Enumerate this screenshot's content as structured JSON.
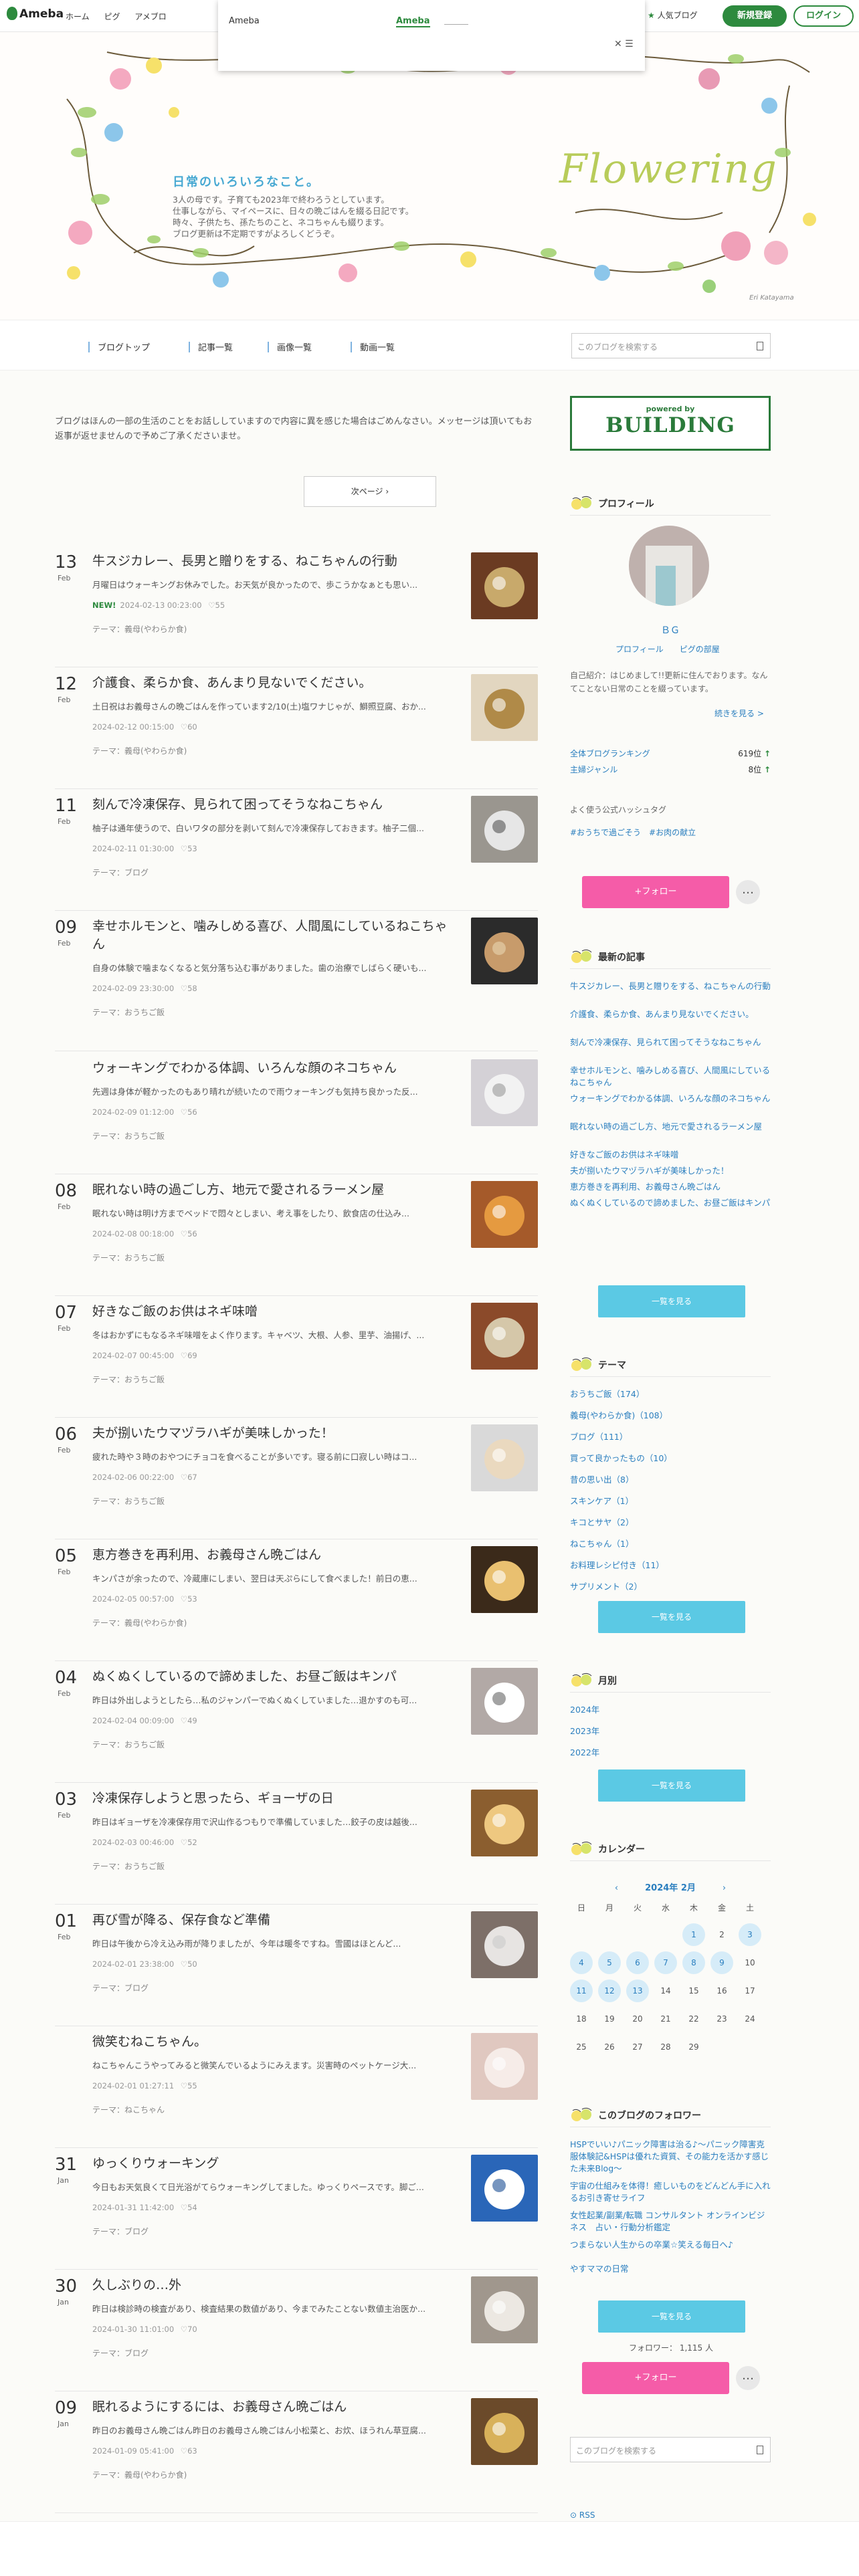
{
  "topbar": {
    "logo": "Ameba",
    "nav": [
      "ホーム",
      "ピグ",
      "アメブロ"
    ],
    "popup_tab1": "Ameba",
    "popup_tab2": "Ameba",
    "popular": "人気ブログ",
    "register": "新規登録",
    "login": "ログイン"
  },
  "header": {
    "title": "日常のいろいろなこと。",
    "desc": [
      "3人の母です。子育ても2023年で終わろうとしています。",
      "仕事しながら、マイペースに、日々の晩ごはんを綴る日記です。",
      "時々、子供たち、孫たちのこと、ネコちゃんも綴ります。",
      "ブログ更新は不定期ですがよろしくどうぞ。"
    ],
    "art_title": "Flowering",
    "signature": "Eri Katayama"
  },
  "blognav": {
    "items": [
      "ブログトップ",
      "記事一覧",
      "画像一覧",
      "動画一覧"
    ],
    "search_placeholder": "このブログを検索する"
  },
  "notice": "ブログはほんの一部の生活のことをお話ししていますので内容に異を感じた場合はごめんなさい。メッセージは頂いてもお返事が返せませんので予めご了承くださいませ。",
  "next_page": "次ページ",
  "articles": [
    {
      "day": "13",
      "mon": "Feb",
      "title": "牛スジカレー、長男と贈りをする、ねこちゃんの行動",
      "excerpt": "月曜日はウォーキングお休みでした。お天気が良かったので、歩こうかなぁとも思い...",
      "new": "NEW!",
      "date": "2024-02-13 00:23:00",
      "likes": "55",
      "theme": "テーマ：義母(やわらか食)"
    },
    {
      "day": "12",
      "mon": "Feb",
      "title": "介護食、柔らか食、あんまり見ないでください。",
      "excerpt": "土日祝はお義母さんの晩ごはんを作っています2/10(土)塩ワナじゃが、鰤照豆腐、おか...",
      "new": "",
      "date": "2024-02-12 00:15:00",
      "likes": "60",
      "theme": "テーマ：義母(やわらか食)"
    },
    {
      "day": "11",
      "mon": "Feb",
      "title": "刻んで冷凍保存、見られて困ってそうなねこちゃん",
      "excerpt": "柚子は通年使うので、白いワタの部分を剥いて刻んで冷凍保存しておきます。柚子二個...",
      "new": "",
      "date": "2024-02-11 01:30:00",
      "likes": "53",
      "theme": "テーマ：ブログ"
    },
    {
      "day": "09",
      "mon": "Feb",
      "title": "幸せホルモンと、噛みしめる喜び、人間風にしているねこちゃん",
      "excerpt": "自身の体験で噛まなくなると気分落ち込む事がありました。歯の治療でしばらく硬いも...",
      "new": "",
      "date": "2024-02-09 23:30:00",
      "likes": "58",
      "theme": "テーマ：おうちご飯"
    },
    {
      "day": "",
      "mon": "",
      "title": "ウォーキングでわかる体調、いろんな顔のネコちゃん",
      "excerpt": "先週は身体が軽かったのもあり晴れが続いたので雨ウォーキングも気持ち良かった反...",
      "new": "",
      "date": "2024-02-09 01:12:00",
      "likes": "56",
      "theme": "テーマ：おうちご飯"
    },
    {
      "day": "08",
      "mon": "Feb",
      "title": "眠れない時の過ごし方、地元で愛されるラーメン屋",
      "excerpt": "眠れない時は明け方までベッドで悶々としまい、考え事をしたり、飲食店の仕込み...",
      "new": "",
      "date": "2024-02-08 00:18:00",
      "likes": "56",
      "theme": "テーマ：おうちご飯"
    },
    {
      "day": "07",
      "mon": "Feb",
      "title": "好きなご飯のお供はネギ味噌",
      "excerpt": "冬はおかずにもなるネギ味噌をよく作ります。キャベツ、大根、人参、里芋、油揚げ、...",
      "new": "",
      "date": "2024-02-07 00:45:00",
      "likes": "69",
      "theme": "テーマ：おうちご飯"
    },
    {
      "day": "06",
      "mon": "Feb",
      "title": "夫が捌いたウマヅラハギが美味しかった！",
      "excerpt": "疲れた時や３時のおやつにチョコを食べることが多いです。寝る前に口寂しい時はコ...",
      "new": "",
      "date": "2024-02-06 00:22:00",
      "likes": "67",
      "theme": "テーマ：おうちご飯"
    },
    {
      "day": "05",
      "mon": "Feb",
      "title": "恵方巻きを再利用、お義母さん晩ごはん",
      "excerpt": "キンパさが余ったので、冷蔵庫にしまい、翌日は天ぷらにして食べました！前日の恵...",
      "new": "",
      "date": "2024-02-05 00:57:00",
      "likes": "53",
      "theme": "テーマ：義母(やわらか食)"
    },
    {
      "day": "04",
      "mon": "Feb",
      "title": "ぬくぬくしているので諦めました、お昼ご飯はキンパ",
      "excerpt": "昨日は外出しようとしたら…私のジャンパーでぬくぬくしていました…退かすのも可...",
      "new": "",
      "date": "2024-02-04 00:09:00",
      "likes": "49",
      "theme": "テーマ：おうちご飯"
    },
    {
      "day": "03",
      "mon": "Feb",
      "title": "冷凍保存しようと思ったら、ギョーザの日",
      "excerpt": "昨日はギョーザを冷凍保存用で沢山作るつもりで準備していました…餃子の皮は越後...",
      "new": "",
      "date": "2024-02-03 00:46:00",
      "likes": "52",
      "theme": "テーマ：おうちご飯"
    },
    {
      "day": "01",
      "mon": "Feb",
      "title": "再び雪が降る、保存食など準備",
      "excerpt": "昨日は午後から冷え込み雨が降りましたが、今年は暖冬ですね。雪國はほとんど...",
      "new": "",
      "date": "2024-02-01 23:38:00",
      "likes": "50",
      "theme": "テーマ：ブログ"
    },
    {
      "day": "",
      "mon": "",
      "title": "微笑むねこちゃん。",
      "excerpt": "ねこちゃんこうやってみると微笑んでいるようにみえます。災害時のペットケージ大...",
      "new": "",
      "date": "2024-02-01 01:27:11",
      "likes": "55",
      "theme": "テーマ：ねこちゃん"
    },
    {
      "day": "31",
      "mon": "Jan",
      "title": "ゆっくりウォーキング",
      "excerpt": "今日もお天気良くて日光浴がてらウォーキングしてました。ゆっくりペースです。脚ご...",
      "new": "",
      "date": "2024-01-31 11:42:00",
      "likes": "54",
      "theme": "テーマ：ブログ"
    },
    {
      "day": "30",
      "mon": "Jan",
      "title": "久しぶりの…外",
      "excerpt": "昨日は検診時の検査があり、検査結果の数値があり、今までみたことない数値主治医か...",
      "new": "",
      "date": "2024-01-30 11:01:00",
      "likes": "70",
      "theme": "テーマ：ブログ"
    },
    {
      "day": "09",
      "mon": "Jan",
      "title": "眠れるようにするには、お義母さん晩ごはん",
      "excerpt": "昨日のお義母さん晩ごはん昨日のお義母さん晩ごはん小松菜と、お炊、ほうれん草豆腐...",
      "new": "",
      "date": "2024-01-09 05:41:00",
      "likes": "63",
      "theme": "テーマ：義母(やわらか食)"
    }
  ],
  "sidebar": {
    "banner_top": "powered by",
    "banner_main": "BUILDING",
    "profile": {
      "heading": "プロフィール",
      "name": "ＢＧ",
      "link1": "プロフィール",
      "link2": "ピグの部屋",
      "bio": "自己紹介：はじめまして!!更新に住んでおります。なんてことない日常のことを綴っています。",
      "more": "続きを見る >",
      "rank1_label": "全体ブログランキング",
      "rank1_value": "619位",
      "rank2_label": "主婦ジャンル",
      "rank2_value": "8位",
      "hashtag_heading": "よく使う公式ハッシュタグ",
      "hashtags": "#おうちで過ごそう　#お肉の献立",
      "follow": "+フォロー",
      "more_icon": "…"
    },
    "latest": {
      "heading": "最新の記事",
      "items": [
        "牛スジカレー、長男と贈りをする、ねこちゃんの行動",
        "介護食、柔らか食、あんまり見ないでください。",
        "刻んで冷凍保存、見られて困ってそうなねこちゃん",
        "幸せホルモンと、噛みしめる喜び、人間風にしているねこちゃん",
        "ウォーキングでわかる体調、いろんな顔のネコちゃん",
        "眠れない時の過ごし方、地元で愛されるラーメン屋",
        "好きなご飯のお供はネギ味噌",
        "夫が捌いたウマヅラハギが美味しかった！",
        "恵方巻きを再利用、お義母さん晩ごはん",
        "ぬくぬくしているので諦めました、お昼ご飯はキンパ"
      ],
      "button": "一覧を見る"
    },
    "themes": {
      "heading": "テーマ",
      "items": [
        "おうちご飯（174）",
        "義母(やわらか食)（108）",
        "ブログ（111）",
        "買って良かったもの（10）",
        "昔の思い出（8）",
        "スキンケア（1）",
        "キコとサヤ（2）",
        "ねこちゃん（1）",
        "お料理レシピ付き（11）",
        "サプリメント（2）"
      ],
      "button": "一覧を見る"
    },
    "monthly": {
      "heading": "月別",
      "items": [
        "2024年",
        "2023年",
        "2022年"
      ],
      "button": "一覧を見る"
    },
    "calendar": {
      "heading": "カレンダー",
      "title": "2024年 2月",
      "prev": "‹",
      "next": "›",
      "weekdays": [
        "日",
        "月",
        "火",
        "水",
        "木",
        "金",
        "土"
      ],
      "rows": [
        [
          "",
          "",
          "",
          "",
          "1",
          "2",
          "3"
        ],
        [
          "4",
          "5",
          "6",
          "7",
          "8",
          "9",
          "10"
        ],
        [
          "11",
          "12",
          "13",
          "14",
          "15",
          "16",
          "17"
        ],
        [
          "18",
          "19",
          "20",
          "21",
          "22",
          "23",
          "24"
        ],
        [
          "25",
          "26",
          "27",
          "28",
          "29",
          "",
          ""
        ]
      ],
      "posted_days": [
        "1",
        "3",
        "4",
        "5",
        "6",
        "7",
        "8",
        "9",
        "11",
        "12",
        "13"
      ]
    },
    "followers": {
      "heading": "このブログのフォロワー",
      "items": [
        "HSPでいい♪パニック障害は治る♪～パニック障害克服体験記&HSPは優れた資質、その能力を活かす感じた未来Blog～",
        "宇宙の仕組みを体得！癒しいものをどんどん手に入れるお引き寄せライフ",
        "女性起業/副業/転職 コンサルタント オンラインビジネス　占い・行動分析鑑定",
        "つまらない人生からの卒業☆笑える毎日へ♪",
        "やすママの日常"
      ],
      "button": "一覧を見る",
      "count_label": "フォロワー： 1,115 人",
      "follow": "+フォロー",
      "more_icon": "…"
    },
    "search_placeholder": "このブログを検索する",
    "rss": "RSS"
  }
}
